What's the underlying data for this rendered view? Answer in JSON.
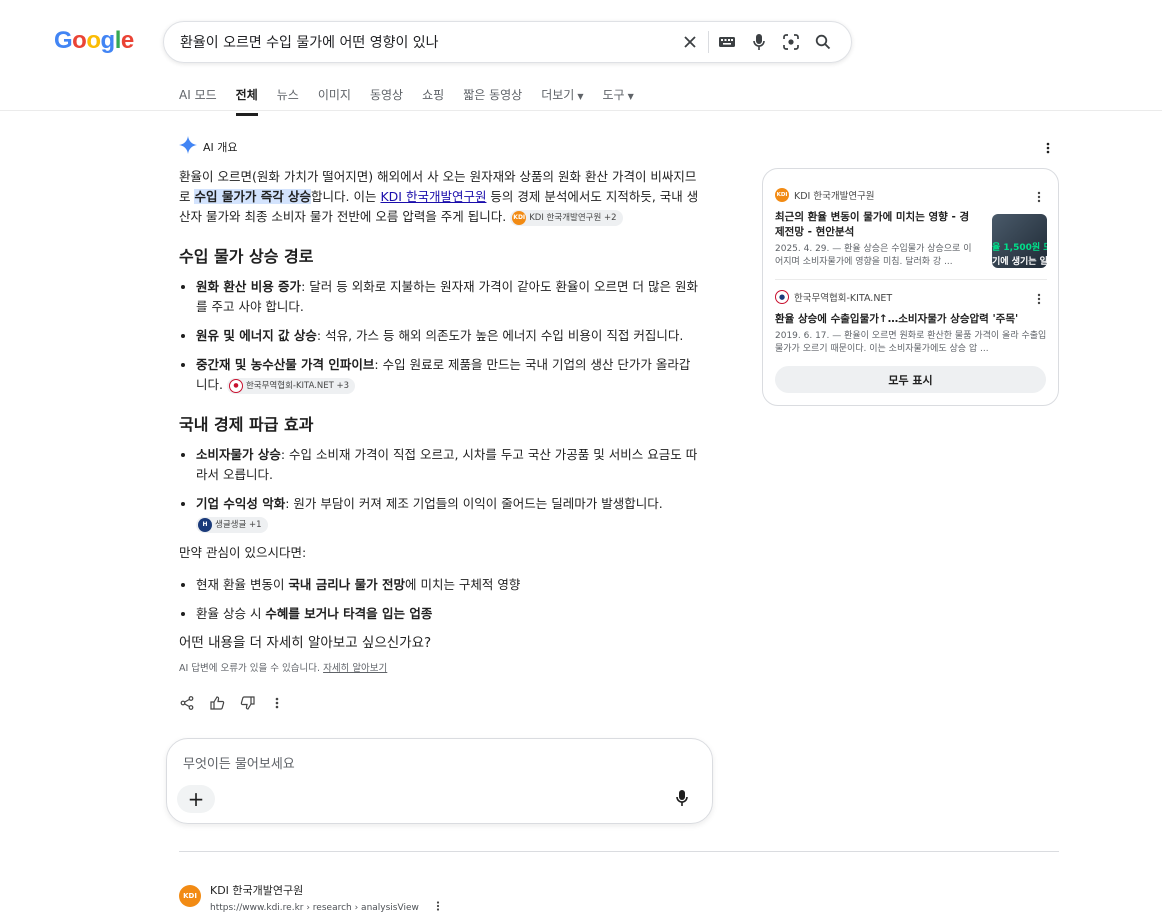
{
  "logo": {
    "text": "Google"
  },
  "search": {
    "query": "환율이 오르면 수입 물가에 어떤 영향이 있나"
  },
  "tabs": [
    {
      "label": "AI 모드"
    },
    {
      "label": "전체",
      "active": true
    },
    {
      "label": "뉴스"
    },
    {
      "label": "이미지"
    },
    {
      "label": "동영상"
    },
    {
      "label": "쇼핑"
    },
    {
      "label": "짧은 동영상"
    },
    {
      "label": "더보기",
      "dropdown": true
    },
    {
      "label": "도구",
      "dropdown": true
    }
  ],
  "ai": {
    "label": "AI 개요",
    "intro": {
      "p1": "환율이 오르면(원화 가치가 떨어지면) 해외에서 사 오는 원자재와 상품의 원화 환산 가격이 비싸지므로 ",
      "highlight": "수입 물가가 즉각 상승",
      "p2": "합니다. 이는 ",
      "link": "KDI 한국개발연구원",
      "p3": " 등의 경제 분석에서도 지적하듯, 국내 생산자 물가와 최종 소비자 물가 전반에 오름 압력을 주게 됩니다.",
      "chip": "KDI 한국개발연구원 +2"
    },
    "section1": {
      "heading": "수입 물가 상승 경로",
      "items": [
        {
          "bold": "원화 환산 비용 증가",
          "text": ": 달러 등 외화로 지불하는 원자재 가격이 같아도 환율이 오르면 더 많은 원화를 주고 사야 합니다."
        },
        {
          "bold": "원유 및 에너지 값 상승",
          "text": ": 석유, 가스 등 해외 의존도가 높은 에너지 수입 비용이 직접 커집니다."
        },
        {
          "bold": "중간재 및 농수산물 가격 인파이브",
          "text": ": 수입 원료로 제품을 만드는 국내 기업의 생산 단가가 올라갑니다.",
          "chip": "한국무역협회-KITA.NET +3"
        }
      ]
    },
    "section2": {
      "heading": "국내 경제 파급 효과",
      "items": [
        {
          "bold": "소비자물가 상승",
          "text": ": 수입 소비재 가격이 직접 오르고, 시차를 두고 국산 가공품 및 서비스 요금도 따라서 오릅니다."
        },
        {
          "bold": "기업 수익성 악화",
          "text": ": 원가 부담이 커져 제조 기업들의 이익이 줄어드는 딜레마가 발생합니다.",
          "chip": "생글생글 +1"
        }
      ]
    },
    "followup": {
      "intro": "만약 관심이 있으시다면:",
      "items": [
        {
          "pre": "현재 환율 변동이 ",
          "bold": "국내 금리나 물가 전망",
          "post": "에 미치는 구체적 영향"
        },
        {
          "pre": "환율 상승 시 ",
          "bold": "수혜를 보거나 타격을 입는 업종",
          "post": ""
        }
      ],
      "question": "어떤 내용을 더 자세히 알아보고 싶으신가요?"
    },
    "disclaimer": "AI 답변에 오류가 있을 수 있습니다.",
    "learn_more": "자세히 알아보기"
  },
  "ask": {
    "placeholder": "무엇이든 물어보세요",
    "plus": "+"
  },
  "sources": [
    {
      "site": "KDI 한국개발연구원",
      "title": "최근의 환율 변동이 물가에 미치는 영향 - 경제전망 - 현안분석",
      "snippet": "2025. 4. 29. — 환율 상승은 수입물가 상승으로 이어지며 소비자물가에 영향을 미침. 달러화 강 ...",
      "thumb_line1": "율 1,500원 모",
      "thumb_line2": "기에 생기는 일"
    },
    {
      "site": "한국무역협회-KITA.NET",
      "title": "환율 상승에 수출입물가↑…소비자물가 상승압력 '주목'",
      "snippet": "2019. 6. 17. — 환율이 오르면 원화로 환산한 물품 가격이 올라 수출입물가가 오르기 때문이다. 이는 소비자물가에도 상승 압 ..."
    }
  ],
  "show_all": "모두 표시",
  "result": {
    "site": "KDI 한국개발연구원",
    "url": "https://www.kdi.re.kr › research › analysisView",
    "fav": "KDI"
  }
}
